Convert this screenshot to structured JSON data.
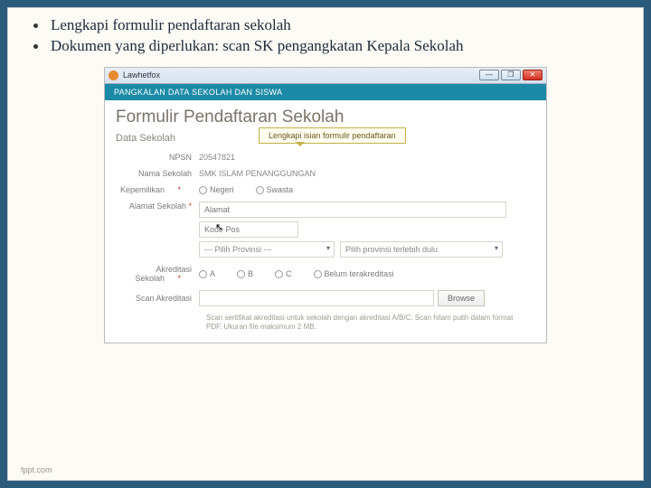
{
  "bullets": [
    "Lengkapi formulir pendaftaran sekolah",
    "Dokumen yang diperlukan: scan SK pengangkatan Kepala Sekolah"
  ],
  "window": {
    "title": "Lawhetfox",
    "min": "—",
    "max": "❐",
    "close": "✕"
  },
  "app_header": "PANGKALAN DATA SEKOLAH DAN SISWA",
  "page_title": "Formulir Pendaftaran Sekolah",
  "section_title": "Data Sekolah",
  "callout": "Lengkapi isian formulir pendaftaran",
  "fields": {
    "npsn_label": "NPSN",
    "npsn_value": "20547821",
    "nama_label": "Nama Sekolah",
    "nama_value": "SMK ISLAM PENANGGUNGAN",
    "kepemilikan_label": "Kepemilikan",
    "kepemilikan_opt1": "Negeri",
    "kepemilikan_opt2": "Swasta",
    "alamat_label": "Alamat Sekolah",
    "alamat_placeholder": "Alamat",
    "kodepos_placeholder": "Kode Pos",
    "provinsi_select": "--- Pilih Provinsi ---",
    "provinsi_hint": "Pilih provinsi terlebih dulu",
    "akreditasi_label": "Akreditasi Sekolah",
    "akr_a": "A",
    "akr_b": "B",
    "akr_c": "C",
    "akr_none": "Belum terakreditasi",
    "scan_label": "Scan Akreditasi",
    "browse": "Browse",
    "scan_helper": "Scan sertifikat akreditasi untuk sekolah dengan akreditasi A/B/C. Scan hitam putih dalam format PDF. Ukuran file maksimum 2 MB."
  },
  "star": "*",
  "footer": "fppt.com"
}
